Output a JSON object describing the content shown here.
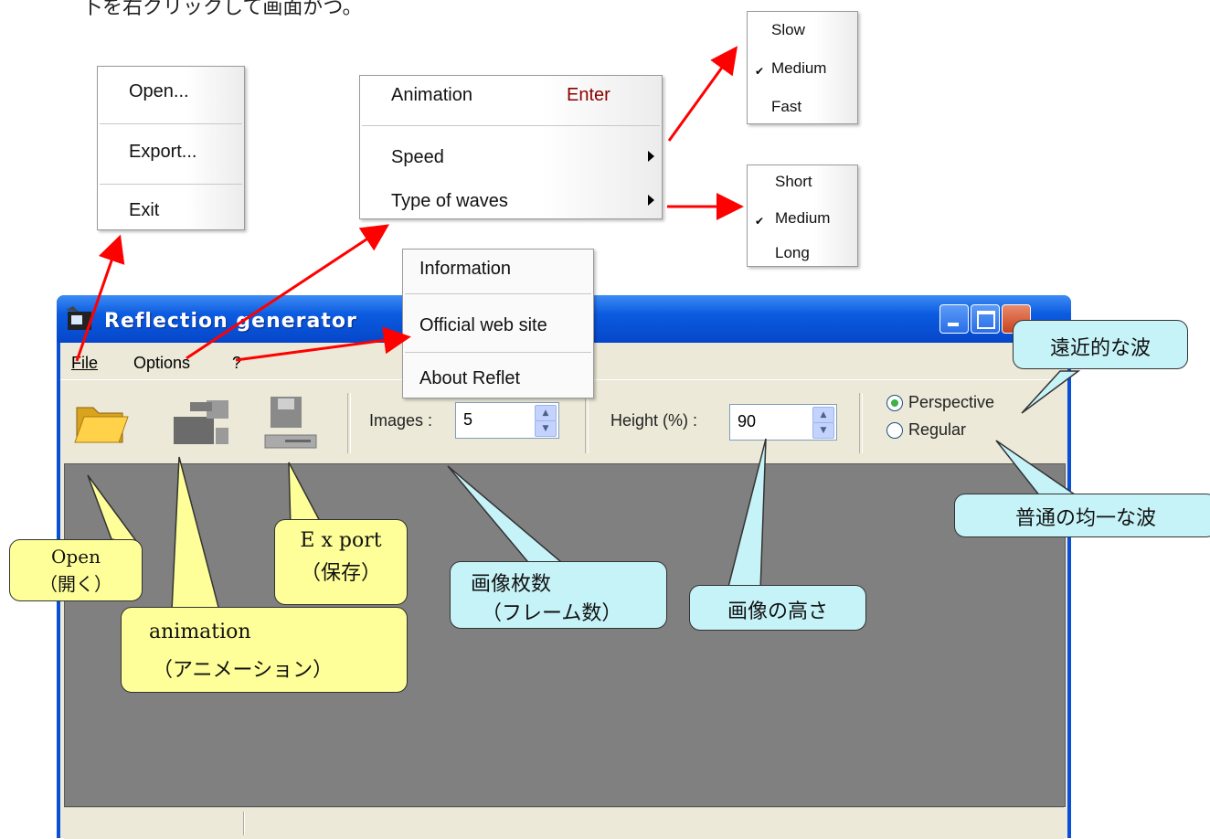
{
  "top_note": "卜を右クリックして画面がつ。",
  "file_menu": {
    "items": [
      "Open...",
      "Export...",
      "Exit"
    ]
  },
  "options_menu": {
    "animation": "Animation",
    "animation_shortcut": "Enter",
    "speed": "Speed",
    "wave_type": "Type of waves"
  },
  "speed_menu": {
    "items": [
      "Slow",
      "Medium",
      "Fast"
    ],
    "checked": "Medium"
  },
  "wave_menu": {
    "items": [
      "Short",
      "Medium",
      "Long"
    ],
    "checked": "Medium"
  },
  "help_menu": {
    "items": [
      "Information",
      "Official web site",
      "About Reflet"
    ]
  },
  "window": {
    "title": "Reflection generator",
    "menubar": [
      "File",
      "Options",
      "?"
    ],
    "toolbar": {
      "images_label": "Images :",
      "images_value": "5",
      "height_label": "Height (%) :",
      "height_value": "90",
      "radio_perspective": "Perspective",
      "radio_regular": "Regular",
      "selected_radio": "Perspective"
    }
  },
  "callouts": {
    "open": [
      "Open",
      "（開く）"
    ],
    "animation": [
      "animation",
      "（アニメーション）"
    ],
    "export": [
      "E x port",
      "（保存）"
    ],
    "images": [
      "画像枚数",
      "（フレーム数）"
    ],
    "height": "画像の高さ",
    "perspective": "遠近的な波",
    "regular": "普通の均一な波"
  },
  "colors": {
    "title_bar": "#0b5be0",
    "callout_yellow": "#ffff99",
    "callout_blue": "#c6f3f8",
    "arrow_red": "#ff0000",
    "canvas": "#808080"
  }
}
